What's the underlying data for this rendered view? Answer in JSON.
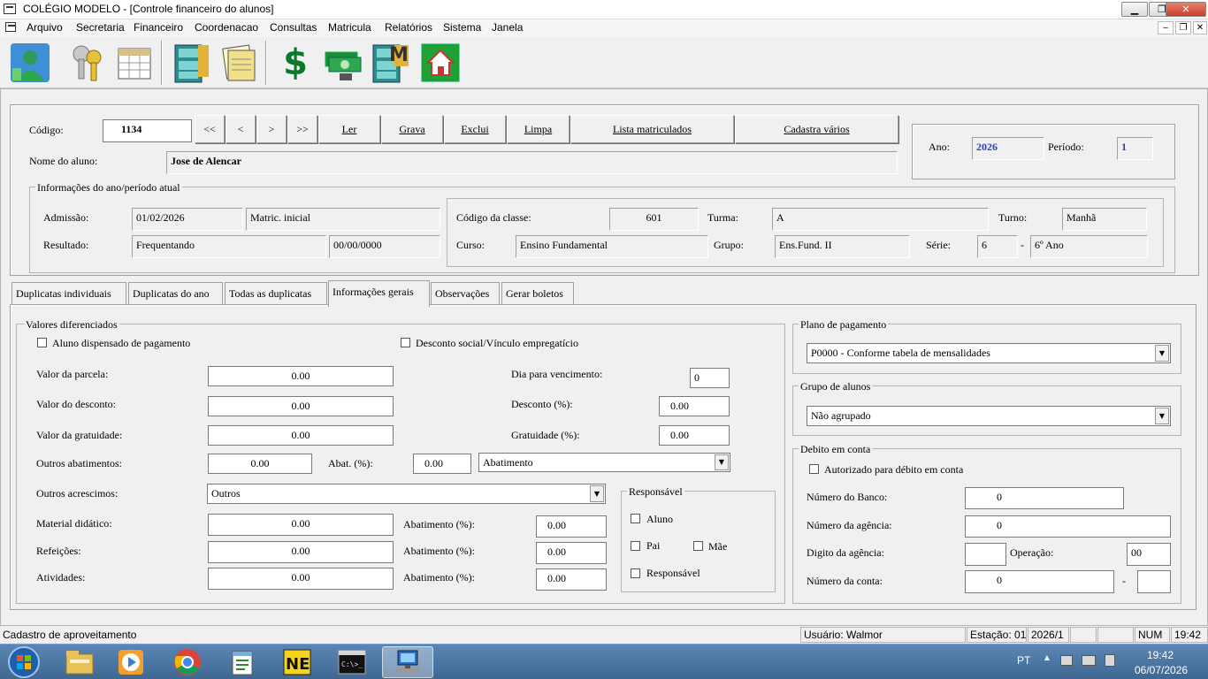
{
  "window": {
    "title": "COLÉGIO MODELO - [Controle financeiro do alunos]",
    "minimize": "▁",
    "restore": "❐",
    "close": "✕"
  },
  "menu": {
    "items": [
      "Arquivo",
      "Secretaria",
      "Financeiro",
      "Coordenacao",
      "Consultas",
      "Matricula",
      "Relatórios",
      "Sistema",
      "Janela"
    ],
    "mdi_min": "‒",
    "mdi_restore": "❐",
    "mdi_close": "✕"
  },
  "toolbar": {
    "icons": [
      "student-icon",
      "keys-icon",
      "calendar-icon",
      "file-cabinet-icon",
      "documents-icon",
      "dollar-icon",
      "money-bills-icon",
      "file-cabinet-m-icon",
      "home-icon"
    ],
    "dollar": "$",
    "m": "M"
  },
  "header": {
    "codigo_label": "Código:",
    "codigo_value": "1134",
    "nav": [
      "<<",
      "<",
      ">",
      ">>"
    ],
    "actions": [
      "Ler",
      "Grava",
      "Exclui",
      "Limpa",
      "Lista matriculados",
      "Cadastra vários"
    ],
    "nome_label": "Nome do aluno:",
    "nome_value": "Jose de Alencar",
    "ano_label": "Ano:",
    "ano_value": "2026",
    "periodo_label": "Período:",
    "periodo_value": "1"
  },
  "info": {
    "title": "Informações do ano/período atual",
    "admissao_label": "Admissão:",
    "admissao_value": "01/02/2026",
    "admissao_tipo": "Matric. inicial",
    "resultado_label": "Resultado:",
    "resultado_value": "Frequentando",
    "resultado_data": "00/00/0000",
    "codclasse_label": "Código da classe:",
    "codclasse_value": "601",
    "turma_label": "Turma:",
    "turma_value": "A",
    "turno_label": "Turno:",
    "turno_value": "Manhã",
    "curso_label": "Curso:",
    "curso_value": "Ensino Fundamental",
    "grupo_label": "Grupo:",
    "grupo_value": "Ens.Fund. II",
    "serie_label": "Série:",
    "serie_value": "6",
    "serie_dash": "-",
    "serie_desc": "6º Ano"
  },
  "tabs": [
    "Duplicatas individuais",
    "Duplicatas do ano",
    "Todas as duplicatas",
    "Informações gerais",
    "Observações",
    "Gerar boletos"
  ],
  "valores": {
    "title": "Valores diferenciados",
    "dispensado": "Aluno dispensado de pagamento",
    "desconto_social": "Desconto social/Vínculo empregatício",
    "parcela_label": "Valor da parcela:",
    "parcela_value": "0.00",
    "desconto_label": "Valor do desconto:",
    "desconto_value": "0.00",
    "gratuidade_label": "Valor da gratuidade:",
    "gratuidade_value": "0.00",
    "dia_label": "Dia para vencimento:",
    "dia_value": "0",
    "descpct_label": "Desconto (%):",
    "descpct_value": "0.00",
    "gratpct_label": "Gratuidade (%):",
    "gratpct_value": "0.00",
    "outros_abat_label": "Outros abatimentos:",
    "outros_abat_value": "0.00",
    "abatpct_label": "Abat. (%):",
    "abatpct_value": "0.00",
    "abat_select": "Abatimento",
    "outros_acresc_label": "Outros acrescimos:",
    "outros_acresc_select": "Outros",
    "material_label": "Material didático:",
    "material_value": "0.00",
    "refeicoes_label": "Refeições:",
    "refeicoes_value": "0.00",
    "atividades_label": "Atividades:",
    "atividades_value": "0.00",
    "abat_label": "Abatimento (%):",
    "abat1": "0.00",
    "abat2": "0.00",
    "abat3": "0.00"
  },
  "responsavel": {
    "title": "Responsável",
    "aluno": "Aluno",
    "pai": "Pai",
    "mae": "Mãe",
    "resp": "Responsável"
  },
  "plano": {
    "title": "Plano de pagamento",
    "value": "P0000 - Conforme tabela de mensalidades"
  },
  "grupo": {
    "title": "Grupo de alunos",
    "value": "Não agrupado"
  },
  "debito": {
    "title": "Debito em conta",
    "autorizado": "Autorizado para débito em conta",
    "banco_label": "Número do Banco:",
    "banco_value": "0",
    "agencia_label": "Número da agência:",
    "agencia_value": "0",
    "digito_label": "Digito da agência:",
    "digito_value": "",
    "operacao_label": "Operação:",
    "operacao_value": "00",
    "conta_label": "Número da conta:",
    "conta_value": "0",
    "conta_dash": "-",
    "conta_dv": ""
  },
  "status": {
    "left": "Cadastro de aproveitamento",
    "usuario": "Usuário: Walmor",
    "estacao": "Estação: 01",
    "periodo": "2026/1",
    "num": "NUM",
    "hora": "19:42"
  },
  "taskbar": {
    "apps": [
      "windows-start-icon",
      "file-explorer-icon",
      "media-player-icon",
      "chrome-icon",
      "notepad-icon",
      "nero-icon",
      "cmd-icon",
      "app-network-icon"
    ],
    "lang": "PT",
    "time": "19:42",
    "date": "06/07/2026",
    "nero": "NE",
    "cmd": "C:\\>_"
  }
}
